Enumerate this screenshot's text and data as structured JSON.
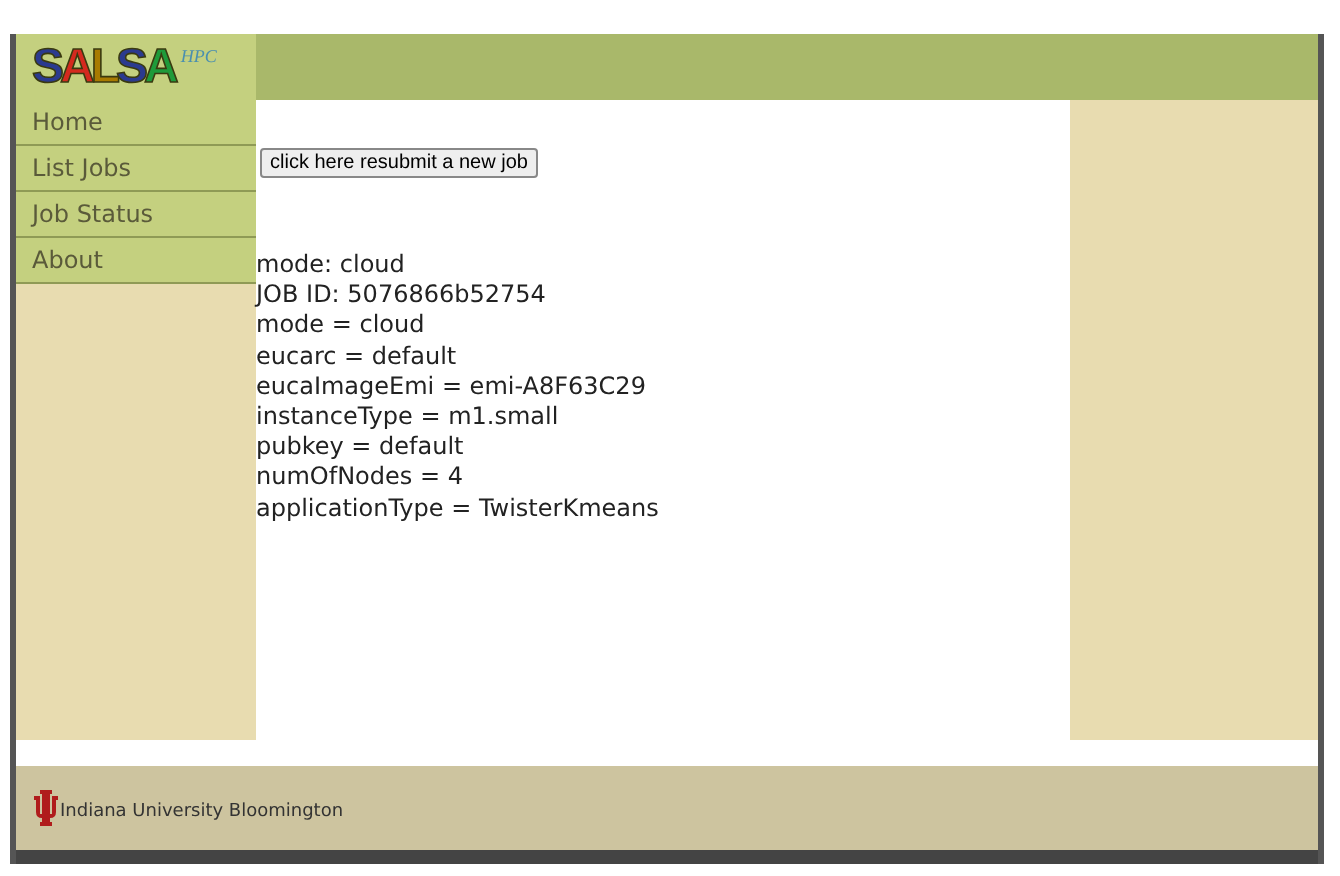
{
  "logo": {
    "letters": [
      {
        "char": "S",
        "color": "#2b3a8f"
      },
      {
        "char": "A",
        "color": "#d42a1e"
      },
      {
        "char": "L",
        "color": "#a87a00"
      },
      {
        "char": "S",
        "color": "#2b3a8f"
      },
      {
        "char": "A",
        "color": "#1f9a3a"
      }
    ],
    "suffix": "HPC"
  },
  "nav": [
    {
      "label": "Home"
    },
    {
      "label": "List Jobs"
    },
    {
      "label": "Job Status"
    },
    {
      "label": "About"
    }
  ],
  "resubmit_button": "click here resubmit a new job",
  "details": [
    "mode: cloud",
    "JOB ID: 5076866b52754",
    "mode = cloud",
    "eucarc = default",
    "eucaImageEmi = emi-A8F63C29",
    "instanceType = m1.small",
    "pubkey = default",
    "numOfNodes = 4",
    "applicationType = TwisterKmeans"
  ],
  "footer": {
    "text": "Indiana University Bloomington"
  }
}
